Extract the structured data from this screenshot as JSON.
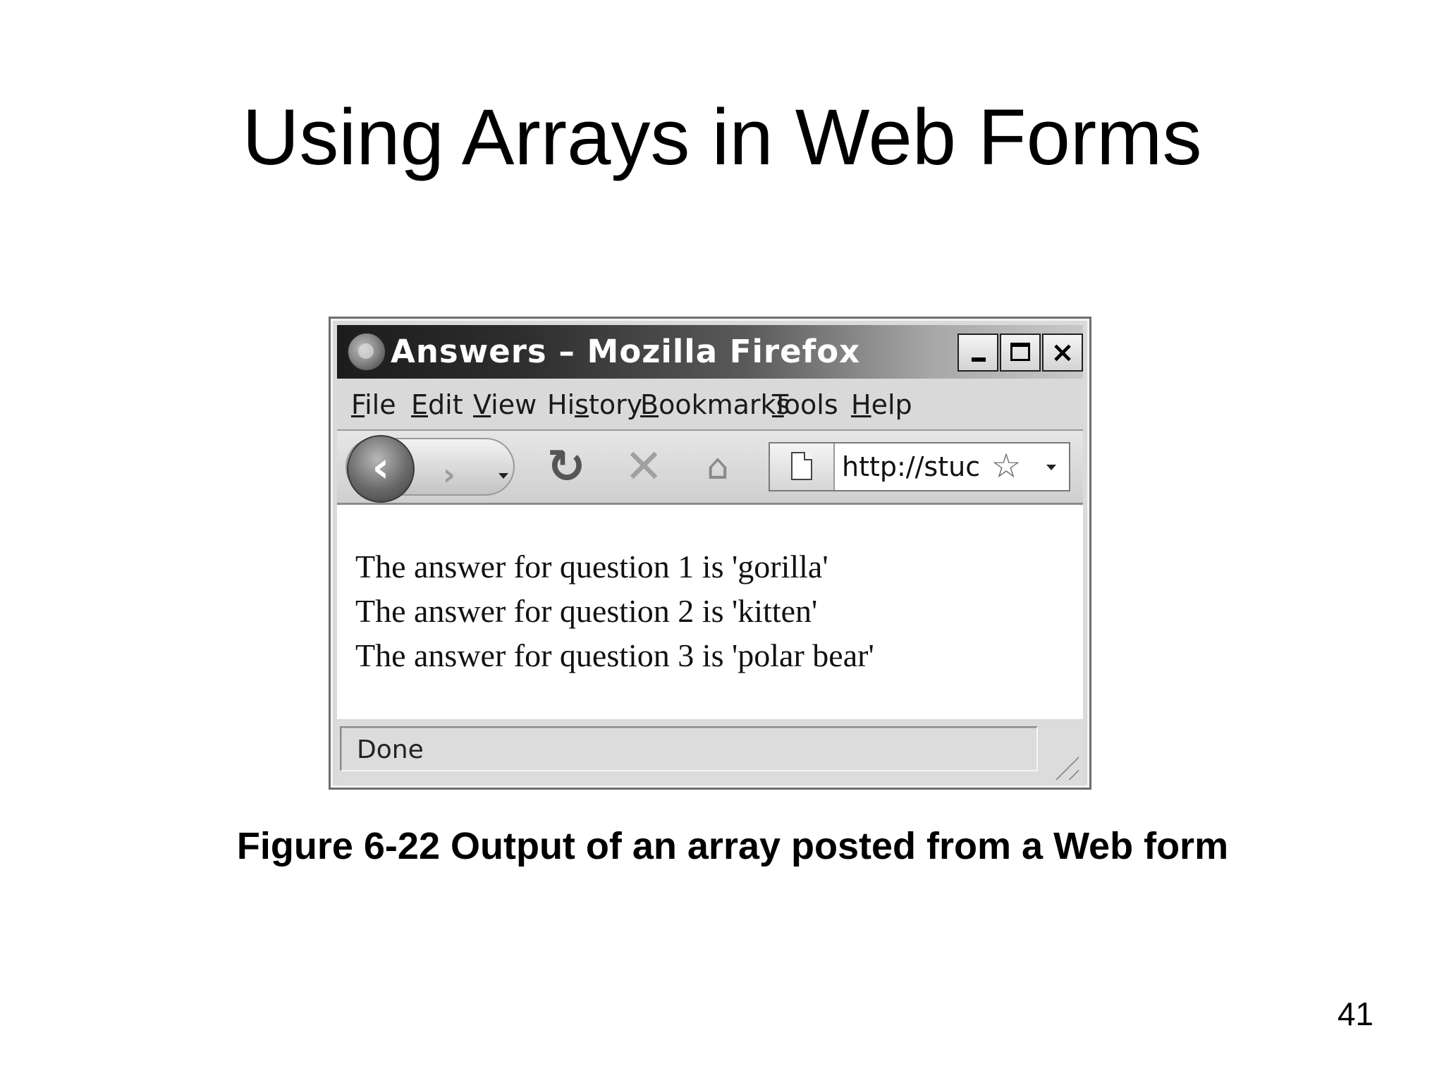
{
  "slide": {
    "title": "Using Arrays in Web Forms",
    "caption": "Figure 6-22 Output of an array posted from a Web form",
    "page_number": "41"
  },
  "window": {
    "title": "Answers – Mozilla Firefox",
    "controls": {
      "minimize": "minimize",
      "maximize": "maximize",
      "close": "×"
    }
  },
  "menu": {
    "file": {
      "u": "F",
      "rest": "ile"
    },
    "edit": {
      "u": "E",
      "rest": "dit"
    },
    "view": {
      "u": "V",
      "rest": "iew"
    },
    "history": {
      "pre": "Hi",
      "u": "s",
      "rest": "tory"
    },
    "bookmarks": {
      "u": "B",
      "rest": "ookmarks"
    },
    "tools": {
      "u": "T",
      "rest": "ools"
    },
    "help": {
      "u": "H",
      "rest": "elp"
    }
  },
  "toolbar": {
    "back_glyph": "‹",
    "forward_glyph": "›",
    "reload_glyph": "↻",
    "stop_glyph": "✕",
    "home_glyph": "⌂",
    "url": "http://stuc",
    "star_glyph": "☆",
    "icons": [
      "back-icon",
      "forward-icon",
      "reload-icon",
      "stop-icon",
      "home-icon",
      "page-icon",
      "star-icon"
    ]
  },
  "content": {
    "lines": [
      "The answer for question 1 is 'gorilla'",
      "The answer for question 2 is 'kitten'",
      "The answer for question 3 is 'polar bear'"
    ]
  },
  "status": {
    "text": "Done"
  }
}
